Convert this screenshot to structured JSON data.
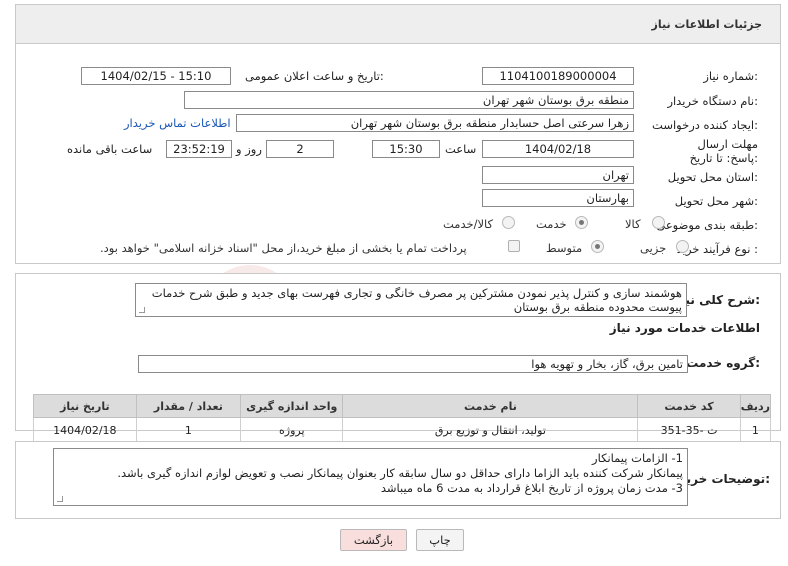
{
  "header": {
    "title": "جزئیات اطلاعات نیاز"
  },
  "watermark": {
    "text": "AriaTender.neT"
  },
  "form": {
    "need_number_label": "شماره نیاز:",
    "need_number": "1104100189000004",
    "announce_label": "تاریخ و ساعت اعلان عمومی:",
    "announce_value": "1404/02/15 - 15:10",
    "buyer_org_label": "نام دستگاه خریدار:",
    "buyer_org": "منطقه برق بوستان شهر تهران",
    "requester_label": "ایجاد کننده درخواست:",
    "requester": "زهرا سرعتی اصل حسابدار منطقه برق بوستان شهر تهران",
    "contact_link": "اطلاعات تماس خریدار",
    "deadline_label": "مهلت ارسال پاسخ: تا تاریخ:",
    "deadline_date": "1404/02/18",
    "time_label": "ساعت",
    "deadline_time": "15:30",
    "days_value": "2",
    "days_label": "روز و",
    "remaining_time": "23:52:19",
    "remaining_label": "ساعت باقی مانده",
    "province_label": "استان محل تحویل:",
    "province": "تهران",
    "city_label": "شهر محل تحویل:",
    "city": "بهارستان",
    "category_label": "طبقه بندی موضوعی:",
    "category_options": [
      "کالا",
      "خدمت",
      "کالا/خدمت"
    ],
    "category_selected": "خدمت",
    "process_label": "نوع فرآیند خرید :",
    "process_options": [
      "جزیی",
      "متوسط"
    ],
    "process_selected": "متوسط",
    "payment_note": "پرداخت تمام یا بخشی از مبلغ خرید،از محل \"اسناد خزانه اسلامی\" خواهد بود."
  },
  "summary": {
    "label": "شرح کلی نیاز:",
    "text": "هوشمند سازی و کنترل پذیر نمودن مشترکین پر مصرف خانگی و تجاری فهرست بهای جدید و طبق شرح خدمات پیوست محدوده منطقه برق بوستان"
  },
  "services": {
    "section_title": "اطلاعات خدمات مورد نیاز",
    "group_label": "گروه خدمت:",
    "group_value": "تامین برق، گاز، بخار و تهویه هوا",
    "columns": [
      "ردیف",
      "کد خدمت",
      "نام خدمت",
      "واحد اندازه گیری",
      "تعداد / مقدار",
      "تاریخ نیاز"
    ],
    "rows": [
      {
        "row": "1",
        "code": "ت -35-351",
        "name": "تولید، انتقال و توزیع برق",
        "unit": "پروژه",
        "qty": "1",
        "date": "1404/02/18"
      }
    ]
  },
  "buyer_notes": {
    "label": "توضیحات خریدار:",
    "lines": [
      "1-    الزامات پیمانکار",
      "پیمانکار شرکت کننده باید الزاما دارای  حداقل دو سال سابقه کار بعنوان پیمانکار نصب و تعویض لوازم اندازه گیری باشد.",
      "3- مدت زمان پروژه از تاریخ ابلاغ قرارداد به مدت 6 ماه میباشد"
    ]
  },
  "buttons": {
    "print": "چاپ",
    "back": "بازگشت"
  },
  "colors": {
    "link": "#1a57b5",
    "back_button_bg": "#f9dede",
    "header_bg": "#eeeeee"
  }
}
